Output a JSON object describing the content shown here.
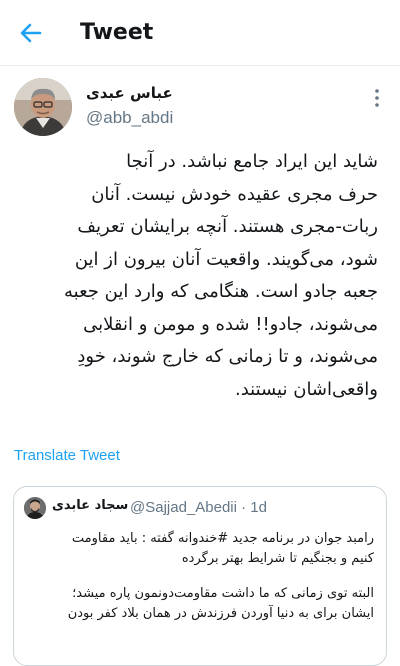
{
  "header": {
    "title": "Tweet",
    "back_icon": "arrow-left-icon"
  },
  "accent_color": "#1da1f2",
  "tweet": {
    "author_name": "عباس عبدی",
    "author_handle": "@abb_abdi",
    "more_icon": "more-vertical-icon",
    "lines": [
      "شاید این ایراد جامع نباشد. در آنجا",
      "حرف مجری عقیده خودش نیست. آنان",
      "ربات-مجری هستند. آنچه برایشان تعریف",
      "شود، می‌گویند. واقعیت آنان بیرون از این",
      "جعبه جادو است. هنگامی که وارد این جعبه",
      "می‌شوند، جادو!! شده و مومن و انقلابی",
      "می‌شوند، و تا زمانی که خارج شوند، خودِ",
      "واقعی‌اشان نیستند."
    ],
    "translate_label": "Translate Tweet"
  },
  "quoted_tweet": {
    "author_name": "سجاد عابدی",
    "author_handle_time": "@Sajjad_Abedii · 1d",
    "lines": [
      "رامبد جوان در برنامه جدید #خندوانه گفته : باید مقاومت",
      "کنیم و بجنگیم تا شرایط بهتر برگرده"
    ],
    "lines2": [
      "البته توی زمانی که ما داشت مقاومت‌دونمون پاره میشد؛",
      "ایشان برای به دنیا آوردن فرزندش در همان بلاد کفر بودن"
    ]
  }
}
